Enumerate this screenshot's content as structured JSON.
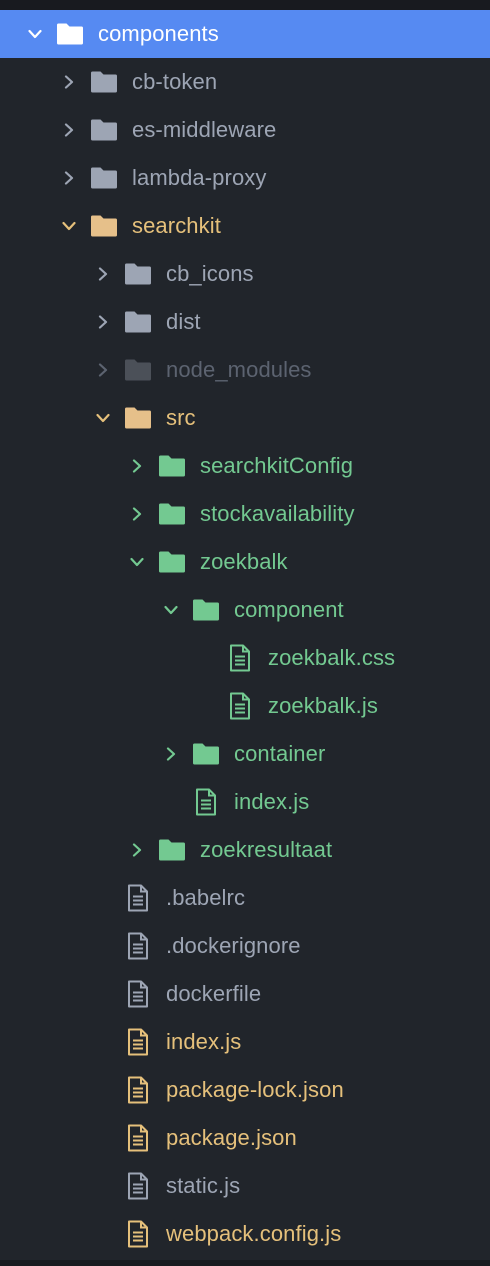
{
  "colors": {
    "background": "#21252b",
    "selection": "#568af2",
    "default_text": "#9da5b4",
    "ignored_text": "#5c6370",
    "modified_text": "#e5c07b",
    "added_text": "#73c991",
    "selected_text": "#ffffff"
  },
  "tree": [
    {
      "name": "components",
      "type": "folder",
      "expanded": true,
      "depth": 0,
      "status": "selected",
      "icon": "folder-icon"
    },
    {
      "name": "cb-token",
      "type": "folder",
      "expanded": false,
      "depth": 1,
      "status": "default",
      "icon": "folder-icon"
    },
    {
      "name": "es-middleware",
      "type": "folder",
      "expanded": false,
      "depth": 1,
      "status": "default",
      "icon": "folder-icon"
    },
    {
      "name": "lambda-proxy",
      "type": "folder",
      "expanded": false,
      "depth": 1,
      "status": "default",
      "icon": "folder-icon"
    },
    {
      "name": "searchkit",
      "type": "folder",
      "expanded": true,
      "depth": 1,
      "status": "modified",
      "icon": "folder-icon"
    },
    {
      "name": "cb_icons",
      "type": "folder",
      "expanded": false,
      "depth": 2,
      "status": "default",
      "icon": "folder-icon"
    },
    {
      "name": "dist",
      "type": "folder",
      "expanded": false,
      "depth": 2,
      "status": "default",
      "icon": "folder-icon"
    },
    {
      "name": "node_modules",
      "type": "folder",
      "expanded": false,
      "depth": 2,
      "status": "ignored",
      "icon": "folder-icon"
    },
    {
      "name": "src",
      "type": "folder",
      "expanded": true,
      "depth": 2,
      "status": "modified",
      "icon": "folder-icon"
    },
    {
      "name": "searchkitConfig",
      "type": "folder",
      "expanded": false,
      "depth": 3,
      "status": "added",
      "icon": "folder-icon"
    },
    {
      "name": "stockavailability",
      "type": "folder",
      "expanded": false,
      "depth": 3,
      "status": "added",
      "icon": "folder-icon"
    },
    {
      "name": "zoekbalk",
      "type": "folder",
      "expanded": true,
      "depth": 3,
      "status": "added",
      "icon": "folder-icon"
    },
    {
      "name": "component",
      "type": "folder",
      "expanded": true,
      "depth": 4,
      "status": "added",
      "icon": "folder-icon"
    },
    {
      "name": "zoekbalk.css",
      "type": "file",
      "depth": 5,
      "status": "added",
      "icon": "file-text-icon"
    },
    {
      "name": "zoekbalk.js",
      "type": "file",
      "depth": 5,
      "status": "added",
      "icon": "file-text-icon"
    },
    {
      "name": "container",
      "type": "folder",
      "expanded": false,
      "depth": 4,
      "status": "added",
      "icon": "folder-icon"
    },
    {
      "name": "index.js",
      "type": "file",
      "depth": 4,
      "status": "added",
      "icon": "file-text-icon"
    },
    {
      "name": "zoekresultaat",
      "type": "folder",
      "expanded": false,
      "depth": 3,
      "status": "added",
      "icon": "folder-icon"
    },
    {
      "name": ".babelrc",
      "type": "file",
      "depth": 2,
      "status": "default",
      "icon": "file-text-icon"
    },
    {
      "name": ".dockerignore",
      "type": "file",
      "depth": 2,
      "status": "default",
      "icon": "file-text-icon"
    },
    {
      "name": "dockerfile",
      "type": "file",
      "depth": 2,
      "status": "default",
      "icon": "file-text-icon"
    },
    {
      "name": "index.js",
      "type": "file",
      "depth": 2,
      "status": "modified",
      "icon": "file-text-icon"
    },
    {
      "name": "package-lock.json",
      "type": "file",
      "depth": 2,
      "status": "modified",
      "icon": "file-text-icon"
    },
    {
      "name": "package.json",
      "type": "file",
      "depth": 2,
      "status": "modified",
      "icon": "file-text-icon"
    },
    {
      "name": "static.js",
      "type": "file",
      "depth": 2,
      "status": "default",
      "icon": "file-text-icon"
    },
    {
      "name": "webpack.config.js",
      "type": "file",
      "depth": 2,
      "status": "modified",
      "icon": "file-text-icon"
    }
  ]
}
